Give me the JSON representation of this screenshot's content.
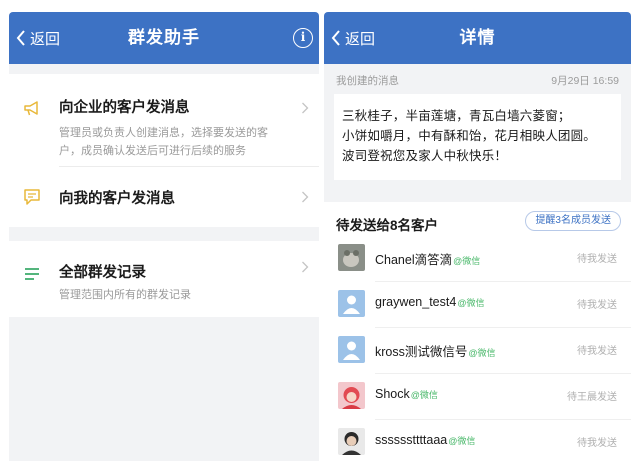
{
  "left": {
    "nav": {
      "back_label": "返回",
      "title": "群发助手"
    },
    "menu": [
      {
        "title": "向企业的客户发消息",
        "desc": "管理员或负责人创建消息，选择要发送的客户，成员确认发送后可进行后续的服务",
        "icon": "megaphone-icon"
      },
      {
        "title": "向我的客户发消息",
        "desc": "",
        "icon": "chat-bubble-icon"
      },
      {
        "title": "全部群发记录",
        "desc": "管理范围内所有的群发记录",
        "icon": "list-icon"
      }
    ]
  },
  "right": {
    "nav": {
      "back_label": "返回",
      "title": "详情"
    },
    "created_label": "我创建的消息",
    "created_time": "9月29日 16:59",
    "message_lines": [
      "三秋桂子，半亩莲塘，青瓦白墙六菱窗；",
      "小饼如嚼月，中有酥和饴，花月相映人团圆。",
      "波司登祝您及家人中秋快乐！"
    ],
    "pending_title": "待发送给8名客户",
    "remind_label": "提醒3名成员发送",
    "contacts": [
      {
        "name": "Chanel滴答滴",
        "tag": "@微信",
        "status": "待我发送"
      },
      {
        "name": "graywen_test4",
        "tag": "@微信",
        "status": "待我发送"
      },
      {
        "name": "kross测试微信号",
        "tag": "@微信",
        "status": "待我发送"
      },
      {
        "name": "Shock",
        "tag": "@微信",
        "status": "待王晨发送"
      },
      {
        "name": "ssssssttttaaa",
        "tag": "@微信",
        "status": "待我发送"
      }
    ]
  },
  "colors": {
    "nav_blue": "#3d72c4",
    "wechat_green": "#49b86a",
    "icon_yellow": "#e8b83a",
    "icon_green": "#3dab6b"
  }
}
